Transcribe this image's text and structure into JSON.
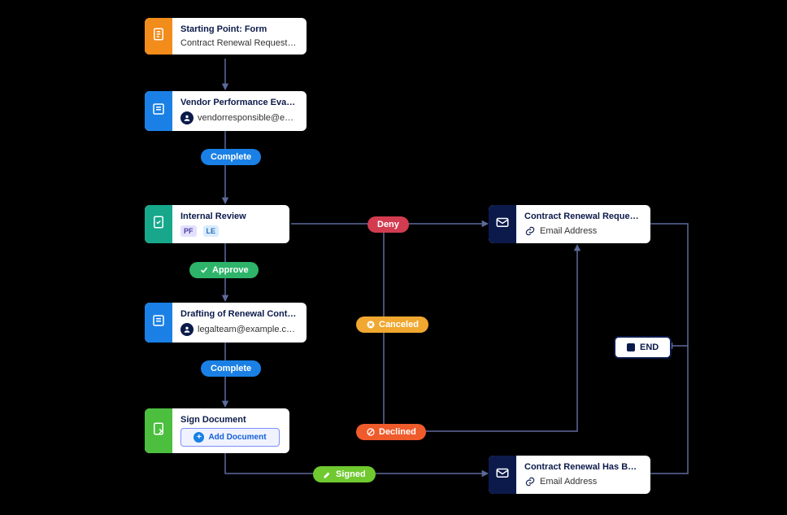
{
  "nodes": {
    "start": {
      "title": "Starting Point: Form",
      "subtitle": "Contract Renewal Request…"
    },
    "vendor": {
      "title": "Vendor Performance Evaluati…",
      "assignee": "vendorresponsible@e…"
    },
    "review": {
      "title": "Internal Review",
      "tag1": "PF",
      "tag2": "LE"
    },
    "draft": {
      "title": "Drafting of Renewal Contract",
      "assignee": "legalteam@example.c…"
    },
    "sign": {
      "title": "Sign Document",
      "action": "Add Document"
    },
    "email1": {
      "title": "Contract Renewal Request H…",
      "link": "Email Address"
    },
    "email2": {
      "title": "Contract Renewal Has Been …",
      "link": "Email Address"
    },
    "end": {
      "label": "END"
    }
  },
  "badges": {
    "complete1": "Complete",
    "approve": "Approve",
    "deny": "Deny",
    "complete2": "Complete",
    "canceled": "Canceled",
    "declined": "Declined",
    "signed": "Signed"
  },
  "colors": {
    "orange": "#f28c1a",
    "blue": "#1a80e5",
    "teal": "#17a88b",
    "green": "#4cbf3f",
    "navy": "#0b1a4a"
  }
}
